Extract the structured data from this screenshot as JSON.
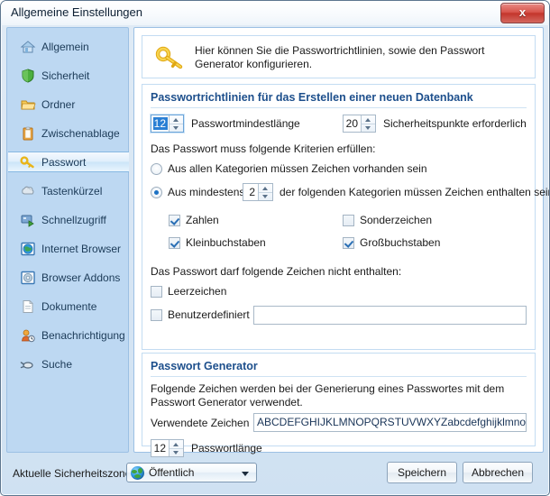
{
  "window": {
    "title": "Allgemeine Einstellungen",
    "close_label": "x"
  },
  "sidebar": {
    "items": [
      {
        "label": "Allgemein",
        "icon": "home-icon",
        "selected": false
      },
      {
        "label": "Sicherheit",
        "icon": "shield-icon",
        "selected": false
      },
      {
        "label": "Ordner",
        "icon": "folder-icon",
        "selected": false
      },
      {
        "label": "Zwischenablage",
        "icon": "clipboard-icon",
        "selected": false
      },
      {
        "label": "Passwort",
        "icon": "key-icon",
        "selected": true
      },
      {
        "label": "Tastenkürzel",
        "icon": "keyboard-icon",
        "selected": false
      },
      {
        "label": "Schnellzugriff",
        "icon": "quickaccess-icon",
        "selected": false
      },
      {
        "label": "Internet Browser",
        "icon": "globe-icon",
        "selected": false
      },
      {
        "label": "Browser Addons",
        "icon": "addon-icon",
        "selected": false
      },
      {
        "label": "Dokumente",
        "icon": "document-icon",
        "selected": false
      },
      {
        "label": "Benachrichtigung",
        "icon": "notify-user-icon",
        "selected": false
      },
      {
        "label": "Suche",
        "icon": "search-icon",
        "selected": false
      }
    ]
  },
  "info": {
    "text": "Hier können Sie die Passwortrichtlinien, sowie den Passwort Generator konfigurieren.",
    "icon": "key-icon"
  },
  "policy": {
    "title": "Passwortrichtlinien für das Erstellen einer neuen Datenbank",
    "min_length_value": "12",
    "min_length_label": "Passwortmindestlänge",
    "security_points_value": "20",
    "security_points_label": "Sicherheitspunkte erforderlich",
    "criteria_heading": "Das Passwort muss folgende Kriterien erfüllen:",
    "radio_all": {
      "label": "Aus allen Kategorien müssen Zeichen vorhanden sein",
      "checked": false
    },
    "radio_at_least": {
      "label_before": "Aus mindestens",
      "value": "2",
      "label_after": "der folgenden Kategorien müssen Zeichen enthalten sein",
      "checked": true
    },
    "categories": [
      {
        "label": "Zahlen",
        "checked": true
      },
      {
        "label": "Sonderzeichen",
        "checked": false
      },
      {
        "label": "Kleinbuchstaben",
        "checked": true
      },
      {
        "label": "Großbuchstaben",
        "checked": true
      }
    ],
    "forbidden_heading": "Das Passwort darf folgende Zeichen nicht enthalten:",
    "forbidden": [
      {
        "label": "Leerzeichen",
        "checked": false
      },
      {
        "label": "Benutzerdefiniert",
        "checked": false
      }
    ],
    "custom_value": "",
    "custom_placeholder": ""
  },
  "generator": {
    "title": "Passwort Generator",
    "description": "Folgende Zeichen werden bei der Generierung eines Passwortes mit dem Passwort Generator verwendet.",
    "charset_label": "Verwendete Zeichen",
    "charset_value": "ABCDEFGHIJKLMNOPQRSTUVWXYZabcdefghijklmnopqrstuvwx",
    "length_value": "12",
    "length_label": "Passwortlänge"
  },
  "footer": {
    "zone_label": "Aktuelle Sicherheitszone",
    "zone_selected": "Öffentlich",
    "save_label": "Speichern",
    "cancel_label": "Abbrechen"
  },
  "colors": {
    "accent_heading": "#1d4f8c",
    "sidebar_bg": "#bdd8f2",
    "close_red": "#c3352c",
    "selection_blue": "#2a7fd4"
  }
}
